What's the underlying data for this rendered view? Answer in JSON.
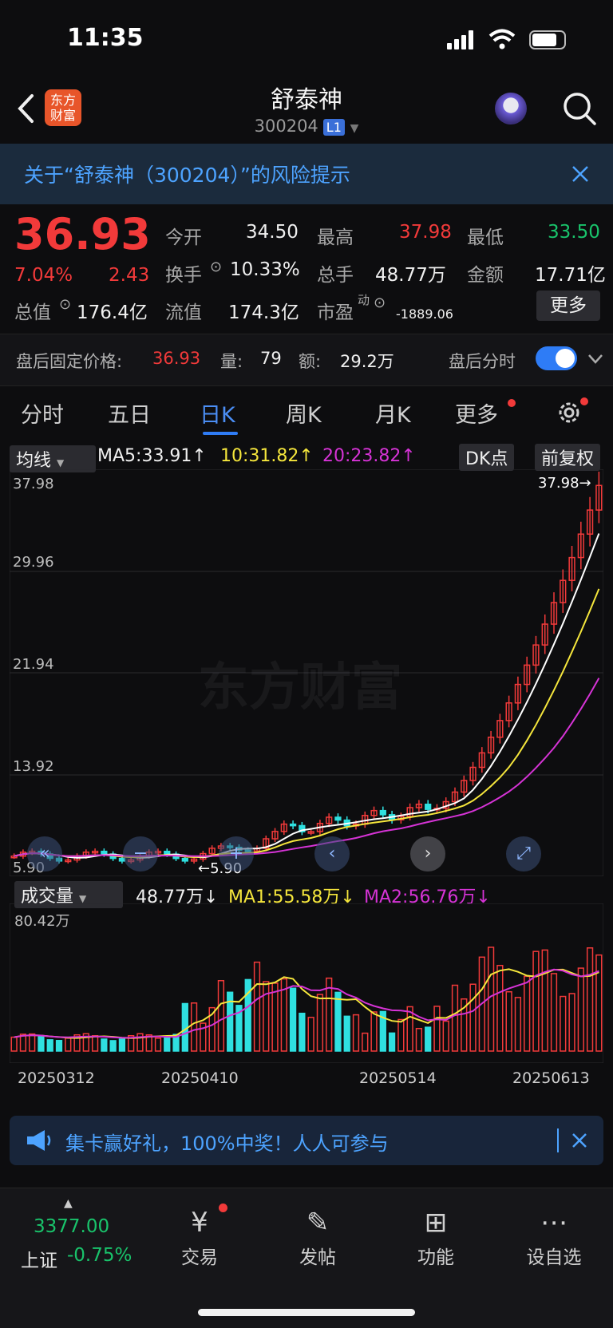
{
  "status_bar": {
    "time": "11:35"
  },
  "header": {
    "title": "舒泰神",
    "code": "300204",
    "level_badge": "L1",
    "logo_text": "东方财富"
  },
  "risk_banner": {
    "text": "关于“舒泰神（300204）”的风险提示"
  },
  "quote": {
    "price": "36.93",
    "change_pct": "7.04%",
    "change": "2.43",
    "open_label": "今开",
    "open": "34.50",
    "high_label": "最高",
    "high": "37.98",
    "low_label": "最低",
    "low": "33.50",
    "turnover_label": "换手",
    "turnover": "10.33%",
    "volume_label": "总手",
    "volume": "48.77万",
    "amount_label": "金额",
    "amount": "17.71亿",
    "mktcap_label": "总值",
    "mktcap": "176.4亿",
    "float_label": "流值",
    "float_cap": "174.3亿",
    "pe_label": "市盈",
    "pe_sup": "动",
    "pe": "-1889.06",
    "more_button": "更多"
  },
  "after_hours": {
    "price_label": "盘后固定价格:",
    "price": "36.93",
    "vol_label": "量:",
    "vol": "79",
    "amt_label": "额:",
    "amt": "29.2万",
    "toggle_label": "盘后分时",
    "toggle_on": true
  },
  "tabs": [
    "分时",
    "五日",
    "日K",
    "周K",
    "月K",
    "更多"
  ],
  "active_tab": "日K",
  "ma_bar": {
    "select": "均线",
    "ma5": "MA5:33.91↑",
    "ma10": "10:31.82↑",
    "ma20": "20:23.82↑",
    "dk_button": "DK点",
    "adjust_button": "前复权"
  },
  "axis": {
    "y_labels": [
      "37.98",
      "29.96",
      "21.94",
      "13.92",
      "5.90"
    ],
    "max_marker": "37.98→",
    "min_marker": "←5.90",
    "watermark": "东方财富"
  },
  "vol_bar": {
    "select": "成交量",
    "vol": "48.77万↓",
    "ma1": "MA1:55.58万↓",
    "ma2": "MA2:56.76万↓",
    "y_max": "80.42万"
  },
  "dates": [
    "20250312",
    "20250410",
    "20250514",
    "20250613"
  ],
  "promo": {
    "text": "集卡赢好礼，100%中奖！人人可参与"
  },
  "bottom_nav": {
    "index_value": "3377.00",
    "index_name": "上证",
    "index_change": "-0.75%",
    "items": [
      "交易",
      "发帖",
      "功能",
      "设自选"
    ]
  },
  "colors": {
    "up": "#f23a3a",
    "down": "#2fe0e0",
    "ma5": "#ffffff",
    "ma10": "#f5e63c",
    "ma20": "#d633d6",
    "accent": "#2f7cf5"
  }
}
